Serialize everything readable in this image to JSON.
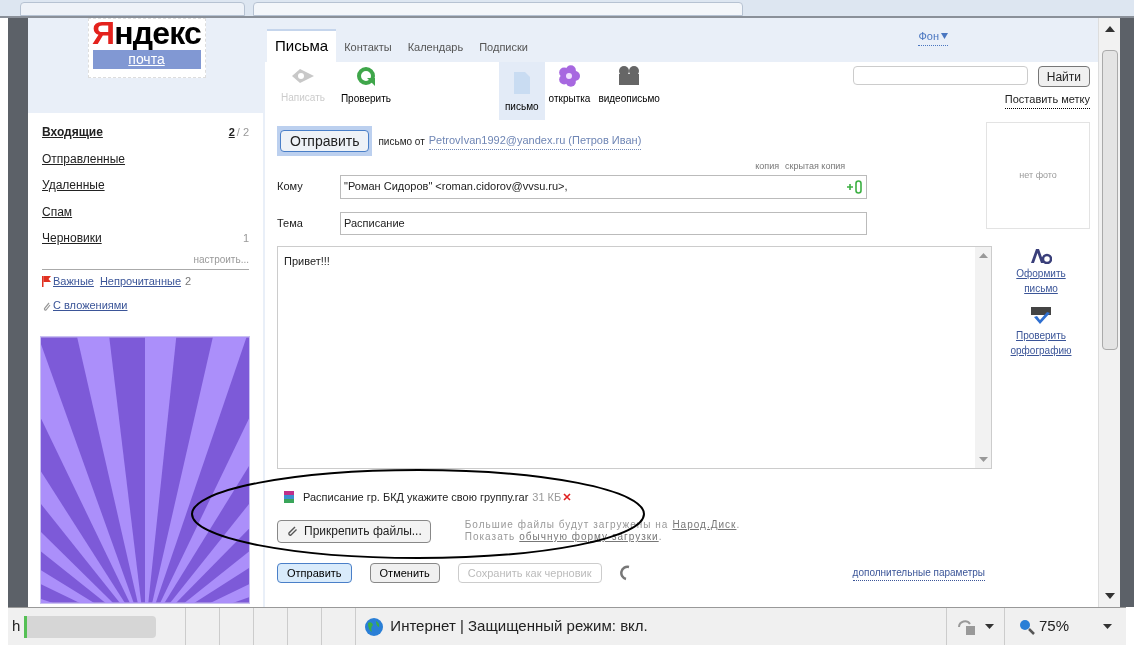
{
  "logo": {
    "wordmark": "Яндекс",
    "service": "почта"
  },
  "folders": [
    {
      "label": "Входящие",
      "selected": true,
      "count": "2",
      "total": "/ 2"
    },
    {
      "label": "Отправленные",
      "selected": false
    },
    {
      "label": "Удаленные",
      "selected": false
    },
    {
      "label": "Спам",
      "selected": false
    },
    {
      "label": "Черновики",
      "selected": false,
      "count": "1"
    }
  ],
  "folders_settings": "настроить...",
  "filter_rows": [
    {
      "items": [
        {
          "kind": "flag",
          "label": "Важные"
        },
        {
          "kind": "plain",
          "label": "Непрочитанные",
          "count": "2"
        }
      ]
    },
    {
      "items": [
        {
          "kind": "clip",
          "label": "С вложениями"
        }
      ]
    }
  ],
  "tabs": [
    {
      "label": "Письма",
      "selected": true
    },
    {
      "label": "Контакты",
      "selected": false
    },
    {
      "label": "Календарь",
      "selected": false
    },
    {
      "label": "Подписки",
      "selected": false
    }
  ],
  "background_menu": "Фон",
  "tools": [
    {
      "kind": "compose",
      "label": "Написать",
      "disabled": true,
      "selected": false
    },
    {
      "kind": "check",
      "label": "Проверить",
      "disabled": false,
      "selected": false
    },
    {
      "kind": "letter",
      "label": "письмо",
      "disabled": false,
      "selected": true
    },
    {
      "kind": "postcard",
      "label": "открытка",
      "disabled": false,
      "selected": false
    },
    {
      "kind": "video",
      "label": "видеописьмо",
      "disabled": false,
      "selected": false
    }
  ],
  "search": {
    "button": "Найти"
  },
  "label_link": "Поставить метку",
  "compose": {
    "send_top": "Отправить",
    "from_prefix": "письмо от",
    "from": "PetrovIvan1992@yandex.ru (Петров Иван)",
    "copy_links": [
      "копия",
      "скрытая копия"
    ],
    "to_label": "Кому",
    "to": "\"Роман Сидоров\" <roman.cidorov@vvsu.ru>,",
    "subject_label": "Тема",
    "subject": "Расписание",
    "body": "Привет!!!",
    "photo": "нет фото"
  },
  "side_tools": [
    {
      "kind": "format",
      "label": "Оформить письмо"
    },
    {
      "kind": "spell",
      "label": "Проверить орфографию"
    }
  ],
  "attachment": {
    "name": "Расписание гр. БКД укажите свою группу.rar",
    "size": "31 КБ"
  },
  "attach_button": "Прикрепить файлы...",
  "attach_hints": [
    {
      "text": "Большие файлы будут загружены на",
      "link": "Народ.Диск",
      "end": "."
    },
    {
      "text": "Показать",
      "link": "обычную форму загрузки",
      "end": "."
    }
  ],
  "actions": [
    {
      "kind": "primary",
      "label": "Отправить",
      "disabled": false
    },
    {
      "kind": "normal",
      "label": "Отменить",
      "disabled": false
    },
    {
      "kind": "normal",
      "label": "Сохранить как черновик",
      "disabled": true
    }
  ],
  "more_params": "дополнительные параметры",
  "status_bar": {
    "address": "h",
    "progress": {
      "level": 0.02
    },
    "zone": "Интернет | Защищенный режим: вкл.",
    "zoom": "75%"
  }
}
